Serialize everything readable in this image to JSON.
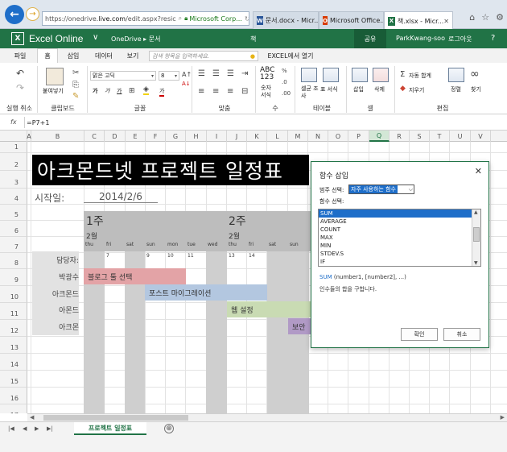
{
  "browser": {
    "url_pre": "https://onedrive.",
    "url_domain": "live.com",
    "url_post": "/edit.aspx?resic",
    "site_identity": "Microsoft Corp...",
    "tabs": [
      {
        "label": "문서.docx - Micr...",
        "color": "#2b579a",
        "glyph": "W"
      },
      {
        "label": "Microsoft Office...",
        "color": "#d83b01",
        "glyph": "O"
      },
      {
        "label": "책.xlsx - Micr...",
        "color": "#217346",
        "glyph": "X"
      }
    ]
  },
  "app": {
    "logo": "X",
    "name": "Excel Online",
    "breadcrumb": "OneDrive ▸ 문서",
    "doc_title": "책",
    "share": "공유",
    "user": "ParkKwang-soo",
    "logout": "로그아웃",
    "help": "?"
  },
  "ribbon_tabs": [
    "파일",
    "홈",
    "삽입",
    "데이터",
    "보기"
  ],
  "ribbon_active": "홈",
  "tell_me_placeholder": "검색 항목을 입력하세요.",
  "open_in_excel": "EXCEL에서 열기",
  "ribbon": {
    "undo_label": "실행 취소",
    "paste_label": "붙여넣기",
    "clipboard_label": "클립보드",
    "font_name": "맑은 고딕",
    "font_size": "8",
    "bold": "가",
    "italic": "가",
    "underline": "가",
    "font_color": "가",
    "font_label": "글꼴",
    "align_label": "맞춤",
    "number_format": "숫자 서식",
    "number_label": "수",
    "number_icon": "ABC\n123",
    "cond_format": "셀균 조사",
    "table_format": "표 서식",
    "table_label": "테이블",
    "insert": "삽입",
    "delete": "삭제",
    "cells_label": "셀",
    "autosum": "자동 합계",
    "clear": "지우기",
    "sort": "정렬",
    "find": "찾기",
    "edit_label": "편집"
  },
  "formula_bar": {
    "fx": "fx",
    "formula": "=P7+1"
  },
  "columns": [
    "A",
    "B",
    "C",
    "D",
    "E",
    "F",
    "G",
    "H",
    "I",
    "J",
    "K",
    "L",
    "M",
    "N",
    "O",
    "P",
    "Q",
    "R",
    "S",
    "T",
    "U",
    "V"
  ],
  "selected_column": "Q",
  "rows": [
    "1",
    "2",
    "3",
    "4",
    "5",
    "6",
    "7",
    "8",
    "9",
    "10",
    "11",
    "12",
    "13",
    "14",
    "15",
    "16",
    "17"
  ],
  "sheet": {
    "title": "아크몬드넷 프로젝트 일정표",
    "start_label": "시작일:",
    "start_date": "2014/2/6",
    "week1": "1주",
    "week2": "2주",
    "month1": "2월",
    "month2": "2월",
    "days_w1": [
      "thu",
      "fri",
      "sat",
      "sun",
      "mon",
      "tue",
      "wed"
    ],
    "nums_w1": [
      "6",
      "7",
      "8",
      "9",
      "10",
      "11",
      "12"
    ],
    "days_w2": [
      "thu",
      "fri",
      "sat",
      "sun"
    ],
    "nums_w2": [
      "13",
      "14",
      "15",
      "16"
    ],
    "persons": [
      "담당자:",
      "박광수",
      "아크몬드",
      "아몬드",
      "아크몬"
    ],
    "tasks": [
      {
        "label": "블로그 툴 선택",
        "color": "#e3a3a6"
      },
      {
        "label": "포스트 마이그레이션",
        "color": "#b3c7e0"
      },
      {
        "label": "웹 설정",
        "color": "#c9dbb3"
      },
      {
        "label": "보안",
        "color": "#b19ac6"
      }
    ]
  },
  "dialog": {
    "title": "함수 삽입",
    "close": "✕",
    "category_label": "범주 선택:",
    "category_value": "자주 사용하는 함수",
    "function_label": "함수 선택:",
    "functions": [
      "SUM",
      "AVERAGE",
      "COUNT",
      "MAX",
      "MIN",
      "STDEV.S",
      "IF"
    ],
    "selected_function": "SUM",
    "syntax_name": "SUM",
    "syntax_args": " (number1, [number2], ...)",
    "description": "인수들의 합을 구합니다.",
    "ok": "확인",
    "cancel": "취소"
  },
  "sheet_tabs": [
    "프로젝트 일정표"
  ],
  "add_sheet": "⊕"
}
